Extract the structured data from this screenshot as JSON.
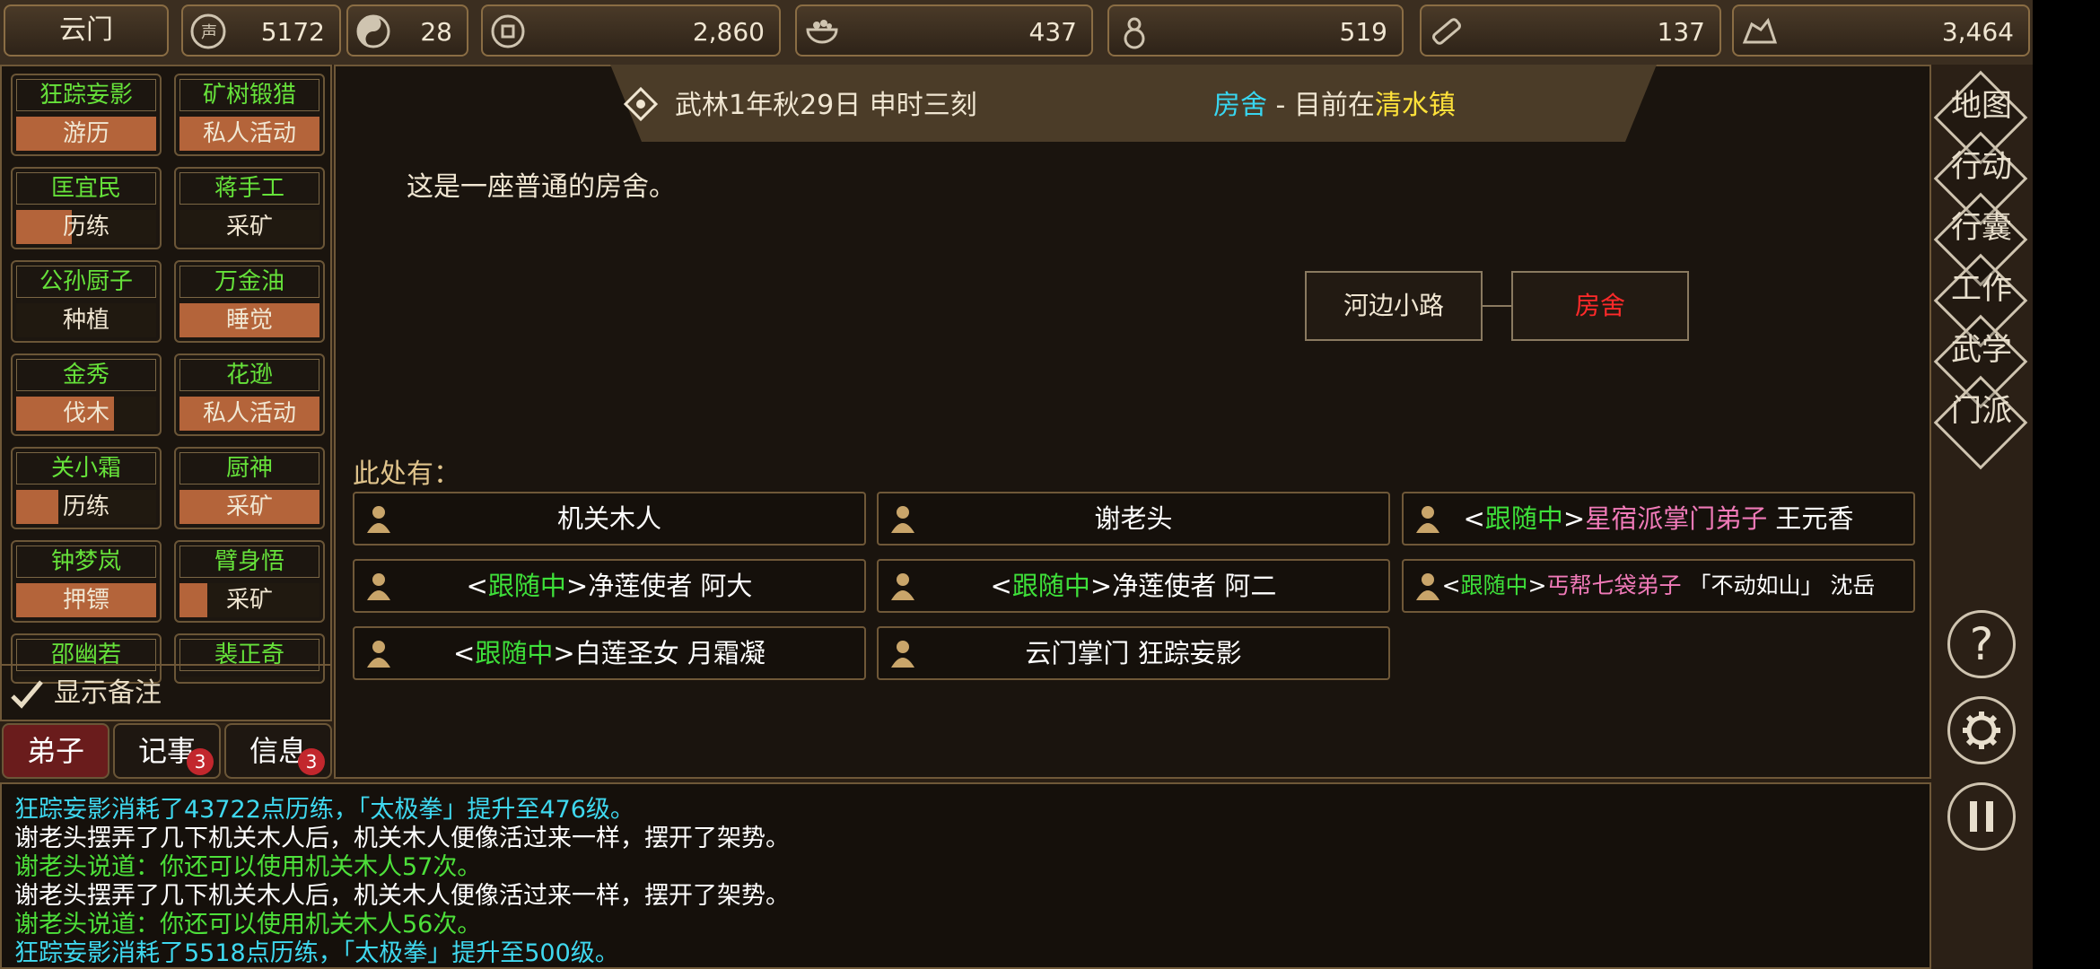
{
  "topbar": {
    "sect_name": "云门",
    "resources": [
      {
        "icon": "reputation-icon",
        "value": "5172"
      },
      {
        "icon": "yin-yang-icon",
        "value": "28"
      },
      {
        "icon": "coin-icon",
        "value": "2,860"
      },
      {
        "icon": "rice-bowl-icon",
        "value": "437"
      },
      {
        "icon": "gourd-icon",
        "value": "519"
      },
      {
        "icon": "wood-log-icon",
        "value": "137"
      },
      {
        "icon": "ore-icon",
        "value": "3,464"
      }
    ]
  },
  "disciples": [
    {
      "name": "狂踪妄影",
      "activity": "游历",
      "progress": 1.0
    },
    {
      "name": "矿树锻猎",
      "activity": "私人活动",
      "progress": 1.0
    },
    {
      "name": "匡宜民",
      "activity": "历练",
      "progress": 0.4
    },
    {
      "name": "蒋手工",
      "activity": "采矿",
      "progress": 0.0
    },
    {
      "name": "公孙厨子",
      "activity": "种植",
      "progress": 0.0
    },
    {
      "name": "万金油",
      "activity": "睡觉",
      "progress": 1.0
    },
    {
      "name": "金秀",
      "activity": "伐木",
      "progress": 0.7
    },
    {
      "name": "花逊",
      "activity": "私人活动",
      "progress": 1.0
    },
    {
      "name": "关小霜",
      "activity": "历练",
      "progress": 0.3
    },
    {
      "name": "厨神",
      "activity": "采矿",
      "progress": 1.0
    },
    {
      "name": "钟梦岚",
      "activity": "押镖",
      "progress": 1.0
    },
    {
      "name": "臂身悟",
      "activity": "采矿",
      "progress": 0.2
    },
    {
      "name": "邵幽若",
      "activity": "",
      "progress": 0.0
    },
    {
      "name": "裴正奇",
      "activity": "",
      "progress": 0.0
    }
  ],
  "show_notes": "显示备注",
  "tabs": [
    {
      "label": "弟子",
      "badge": ""
    },
    {
      "label": "记事",
      "badge": "3"
    },
    {
      "label": "信息",
      "badge": "3"
    }
  ],
  "header": {
    "date": "武林1年秋29日 申时三刻",
    "location_name": "房舍",
    "location_sep": " - 目前在",
    "town": "清水镇"
  },
  "description": "这是一座普通的房舍。",
  "map": {
    "left": "河边小路",
    "current": "房舍"
  },
  "here_label": "此处有：",
  "npcs": [
    {
      "tag": "",
      "title": "",
      "name": "机关木人"
    },
    {
      "tag": "",
      "title": "",
      "name": "谢老头"
    },
    {
      "tag": "跟随中",
      "title": "星宿派掌门弟子",
      "name": "王元香"
    },
    {
      "tag": "跟随中",
      "title": "净莲使者",
      "name": "阿大"
    },
    {
      "tag": "跟随中",
      "title": "净莲使者",
      "name": "阿二"
    },
    {
      "tag": "跟随中",
      "title": "丐帮七袋弟子",
      "nick": "「不动如山」",
      "name": "沈岳"
    },
    {
      "tag": "跟随中",
      "title": "白莲圣女",
      "name": "月霜凝"
    },
    {
      "tag": "",
      "title": "",
      "name": "云门掌门 狂踪妄影"
    }
  ],
  "log": [
    {
      "text": "狂踪妄影消耗了43722点历练，「太极拳」提升至476级。",
      "color": "#3fd8ef"
    },
    {
      "text": "谢老头摆弄了几下机关木人后，机关木人便像活过来一样，摆开了架势。",
      "color": "#ffffff"
    },
    {
      "text": "谢老头说道：你还可以使用机关木人57次。",
      "color": "#4de03a"
    },
    {
      "text": "谢老头摆弄了几下机关木人后，机关木人便像活过来一样，摆开了架势。",
      "color": "#ffffff"
    },
    {
      "text": "谢老头说道：你还可以使用机关木人56次。",
      "color": "#4de03a"
    },
    {
      "text": "狂踪妄影消耗了5518点历练，「太极拳」提升至500级。",
      "color": "#3fd8ef"
    }
  ],
  "rail": [
    "地图",
    "行动",
    "行囊",
    "工作",
    "武学",
    "门派"
  ],
  "colors": {
    "follow": "#3ee03a",
    "title_pink": "#f07ab8",
    "town": "#ffe23a",
    "loc": "#38d6f0",
    "current_map": "#ff2a2a"
  }
}
